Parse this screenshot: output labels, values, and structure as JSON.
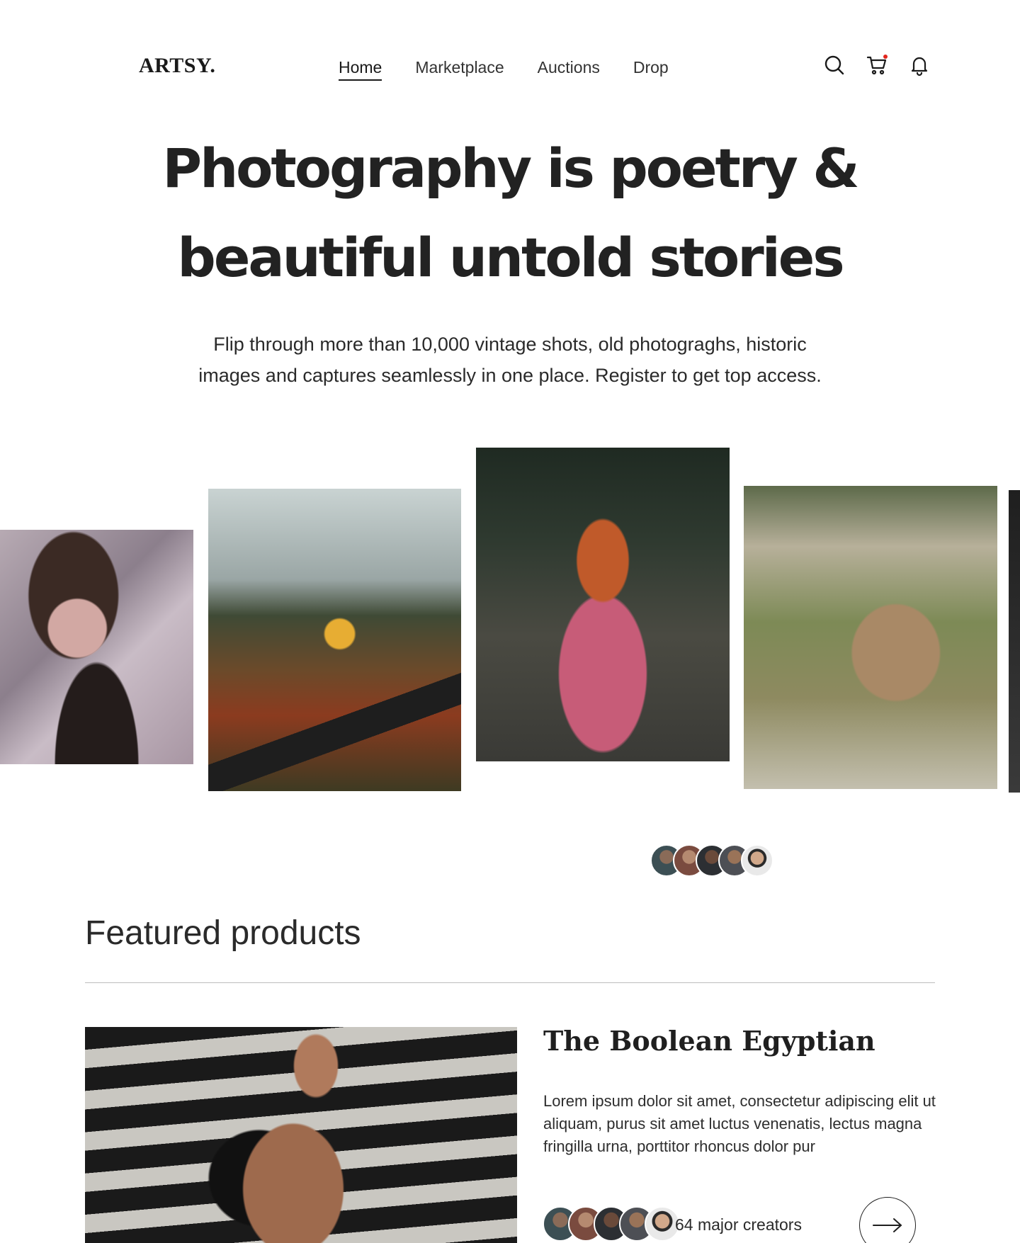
{
  "brand": {
    "logo": "ARTSY."
  },
  "nav": {
    "items": [
      {
        "label": "Home",
        "active": true
      },
      {
        "label": "Marketplace",
        "active": false
      },
      {
        "label": "Auctions",
        "active": false
      },
      {
        "label": "Drop",
        "active": false
      }
    ],
    "icons": [
      "search-icon",
      "cart-icon",
      "bell-icon"
    ],
    "cart_indicator_color": "#e2261d"
  },
  "hero": {
    "title_line1": "Photography is poetry &",
    "title_line2": "beautiful untold stories",
    "subtitle_line1": "Flip through more than 10,000 vintage shots, old photograghs, historic",
    "subtitle_line2": "images and captures seamlessly in one place. Register to get top access."
  },
  "featured": {
    "heading": "Featured products",
    "product": {
      "name": "The Boolean Egyptian",
      "description": "Lorem ipsum dolor sit amet, consectetur adipiscing elit ut aliquam, purus sit amet luctus venenatis, lectus magna fringilla urna, porttitor rhoncus dolor pur",
      "creators_label": "64 major creators"
    }
  }
}
